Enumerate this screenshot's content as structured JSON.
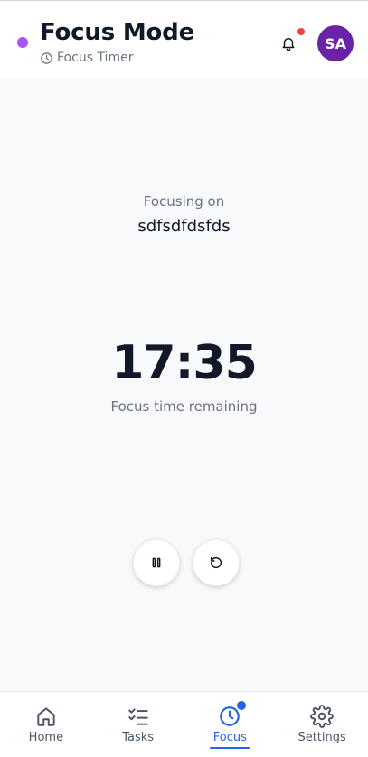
{
  "header": {
    "title": "Focus Mode",
    "subtitle": "Focus Timer",
    "avatar_initials": "SA",
    "status_dot_color": "#a855f7",
    "avatar_color": "#6b21a8",
    "notification_badge_color": "#ef4444"
  },
  "focus": {
    "label": "Focusing on",
    "task_name": "sdfsdfdsfds",
    "time_remaining": "17:35",
    "caption": "Focus time remaining"
  },
  "controls": {
    "pause_icon": "pause-icon",
    "reset_icon": "reset-icon"
  },
  "nav": {
    "accent_color": "#2563eb",
    "items": [
      {
        "label": "Home",
        "icon": "home-icon",
        "active": false
      },
      {
        "label": "Tasks",
        "icon": "tasks-icon",
        "active": false
      },
      {
        "label": "Focus",
        "icon": "clock-icon",
        "active": true
      },
      {
        "label": "Settings",
        "icon": "gear-icon",
        "active": false
      }
    ]
  }
}
